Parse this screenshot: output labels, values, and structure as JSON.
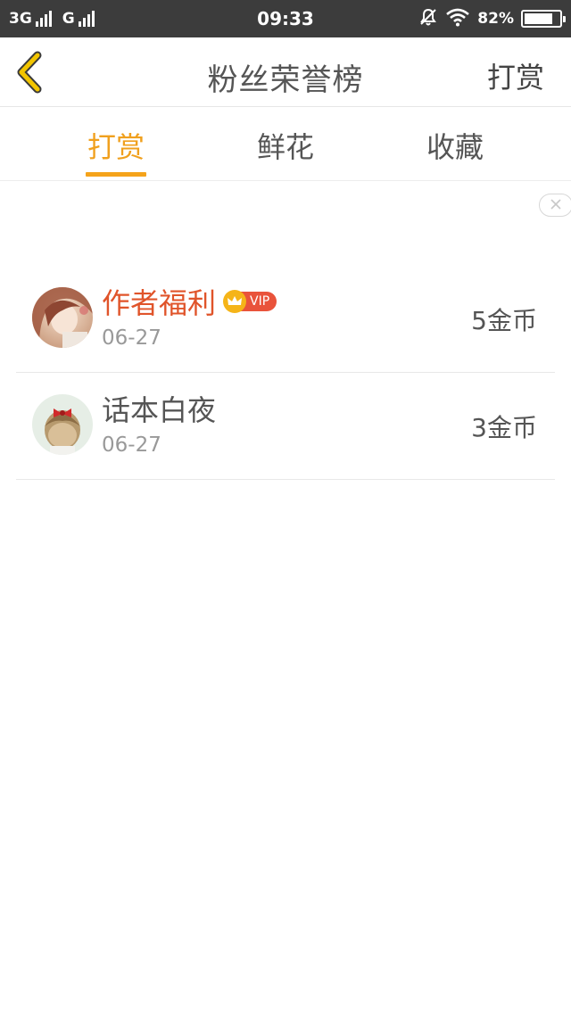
{
  "status_bar": {
    "network_1": "3G",
    "network_2": "G",
    "time": "09:33",
    "battery_text": "82%",
    "battery_level": 0.82,
    "icons": [
      "signal-icon",
      "mute-bell-icon",
      "wifi-icon",
      "battery-icon"
    ]
  },
  "header": {
    "back_icon": "chevron-left-icon",
    "title": "粉丝荣誉榜",
    "action_label": "打赏"
  },
  "tabs": [
    {
      "label": "打赏",
      "active": true
    },
    {
      "label": "鲜花",
      "active": false
    },
    {
      "label": "收藏",
      "active": false
    }
  ],
  "close_icon": "close-icon",
  "list": [
    {
      "name": "作者福利",
      "vip": true,
      "vip_label": "VIP",
      "date": "06-27",
      "amount": "5金币"
    },
    {
      "name": "话本白夜",
      "vip": false,
      "date": "06-27",
      "amount": "3金币"
    }
  ],
  "colors": {
    "accent": "#f5a31a",
    "vip_name": "#e0542a",
    "status_bar": "#3c3c3c"
  }
}
